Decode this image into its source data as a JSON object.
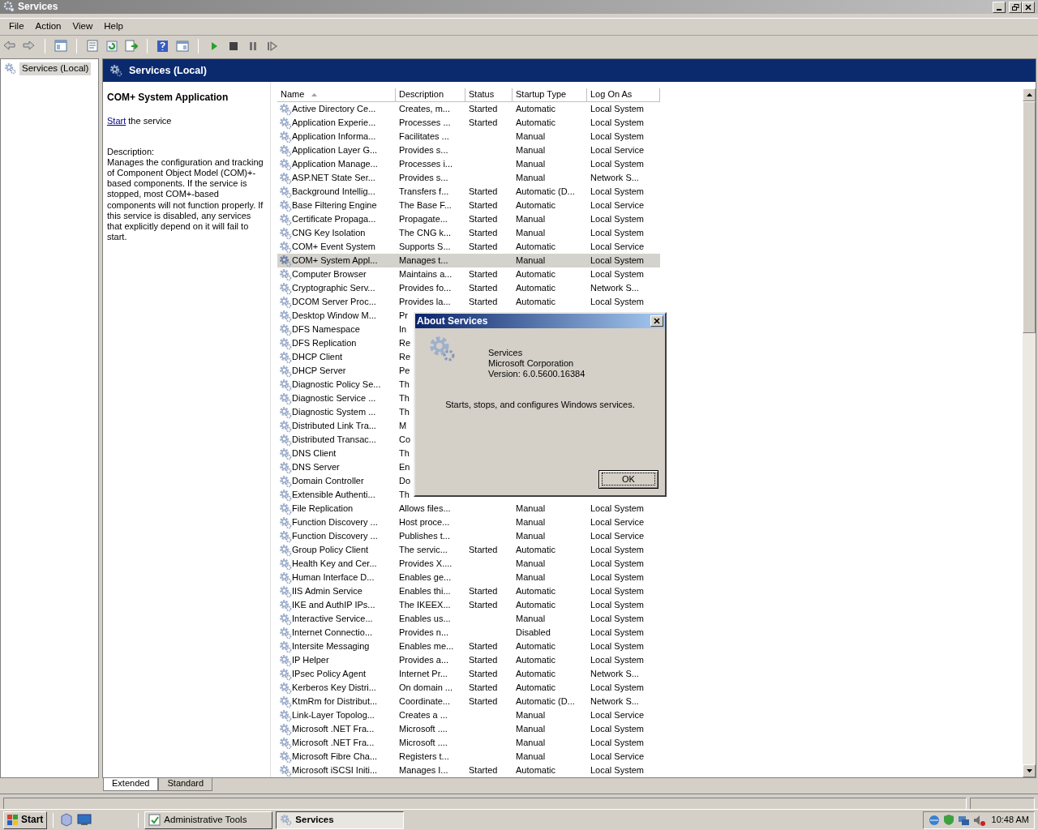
{
  "window": {
    "title": "Services"
  },
  "menu": [
    "File",
    "Action",
    "View",
    "Help"
  ],
  "tree": {
    "items": [
      {
        "label": "Services (Local)",
        "selected": true
      }
    ]
  },
  "panel_header": {
    "title": "Services (Local)"
  },
  "details": {
    "title": "COM+ System Application",
    "action_link": "Start",
    "action_text": "the service",
    "description_label": "Description:",
    "description": "Manages the configuration and tracking of Component Object Model (COM)+-based components. If the service is stopped, most COM+-based components will not function properly. If this service is disabled, any services that explicitly depend on it will fail to start."
  },
  "table": {
    "columns": [
      {
        "label": "Name",
        "sorted": true
      },
      {
        "label": "Description",
        "sorted": false
      },
      {
        "label": "Status",
        "sorted": false
      },
      {
        "label": "Startup Type",
        "sorted": false
      },
      {
        "label": "Log On As",
        "sorted": false
      }
    ],
    "rows": [
      {
        "name": "Active Directory Ce...",
        "description": "Creates, m...",
        "status": "Started",
        "startup_type": "Automatic",
        "log_on_as": "Local System",
        "selected": false
      },
      {
        "name": "Application Experie...",
        "description": "Processes ...",
        "status": "Started",
        "startup_type": "Automatic",
        "log_on_as": "Local System",
        "selected": false
      },
      {
        "name": "Application Informa...",
        "description": "Facilitates ...",
        "startup_type": "Manual",
        "log_on_as": "Local System",
        "selected": false
      },
      {
        "name": "Application Layer G...",
        "description": "Provides s...",
        "startup_type": "Manual",
        "log_on_as": "Local Service",
        "selected": false
      },
      {
        "name": "Application Manage...",
        "description": "Processes i...",
        "startup_type": "Manual",
        "log_on_as": "Local System",
        "selected": false
      },
      {
        "name": "ASP.NET State Ser...",
        "description": "Provides s...",
        "startup_type": "Manual",
        "log_on_as": "Network S...",
        "selected": false
      },
      {
        "name": "Background Intellig...",
        "description": "Transfers f...",
        "status": "Started",
        "startup_type": "Automatic (D...",
        "log_on_as": "Local System",
        "selected": false
      },
      {
        "name": "Base Filtering Engine",
        "description": "The Base F...",
        "status": "Started",
        "startup_type": "Automatic",
        "log_on_as": "Local Service",
        "selected": false
      },
      {
        "name": "Certificate Propaga...",
        "description": "Propagate...",
        "status": "Started",
        "startup_type": "Manual",
        "log_on_as": "Local System",
        "selected": false
      },
      {
        "name": "CNG Key Isolation",
        "description": "The CNG k...",
        "status": "Started",
        "startup_type": "Manual",
        "log_on_as": "Local System",
        "selected": false
      },
      {
        "name": "COM+ Event System",
        "description": "Supports S...",
        "status": "Started",
        "startup_type": "Automatic",
        "log_on_as": "Local Service",
        "selected": false
      },
      {
        "name": "COM+ System Appl...",
        "description": "Manages t...",
        "startup_type": "Manual",
        "log_on_as": "Local System",
        "selected": true
      },
      {
        "name": "Computer Browser",
        "description": "Maintains a...",
        "status": "Started",
        "startup_type": "Automatic",
        "log_on_as": "Local System",
        "selected": false
      },
      {
        "name": "Cryptographic Serv...",
        "description": "Provides fo...",
        "status": "Started",
        "startup_type": "Automatic",
        "log_on_as": "Network S...",
        "selected": false
      },
      {
        "name": "DCOM Server Proc...",
        "description": "Provides la...",
        "status": "Started",
        "startup_type": "Automatic",
        "log_on_as": "Local System",
        "selected": false
      },
      {
        "name": "Desktop Window M...",
        "description": "Pr",
        "selected": false
      },
      {
        "name": "DFS Namespace",
        "description": "In",
        "selected": false
      },
      {
        "name": "DFS Replication",
        "description": "Re",
        "selected": false
      },
      {
        "name": "DHCP Client",
        "description": "Re",
        "selected": false
      },
      {
        "name": "DHCP Server",
        "description": "Pe",
        "selected": false
      },
      {
        "name": "Diagnostic Policy Se...",
        "description": "Th",
        "selected": false
      },
      {
        "name": "Diagnostic Service ...",
        "description": "Th",
        "selected": false
      },
      {
        "name": "Diagnostic System ...",
        "description": "Th",
        "selected": false
      },
      {
        "name": "Distributed Link Tra...",
        "description": "M",
        "selected": false
      },
      {
        "name": "Distributed Transac...",
        "description": "Co",
        "selected": false
      },
      {
        "name": "DNS Client",
        "description": "Th",
        "selected": false
      },
      {
        "name": "DNS Server",
        "description": "En",
        "selected": false
      },
      {
        "name": "Domain Controller",
        "description": "Do",
        "selected": false
      },
      {
        "name": "Extensible Authenti...",
        "description": "Th",
        "selected": false
      },
      {
        "name": "File Replication",
        "description": "Allows files...",
        "startup_type": "Manual",
        "log_on_as": "Local System",
        "selected": false
      },
      {
        "name": "Function Discovery ...",
        "description": "Host proce...",
        "startup_type": "Manual",
        "log_on_as": "Local Service",
        "selected": false
      },
      {
        "name": "Function Discovery ...",
        "description": "Publishes t...",
        "startup_type": "Manual",
        "log_on_as": "Local Service",
        "selected": false
      },
      {
        "name": "Group Policy Client",
        "description": "The servic...",
        "status": "Started",
        "startup_type": "Automatic",
        "log_on_as": "Local System",
        "selected": false
      },
      {
        "name": "Health Key and Cer...",
        "description": "Provides X....",
        "startup_type": "Manual",
        "log_on_as": "Local System",
        "selected": false
      },
      {
        "name": "Human Interface D...",
        "description": "Enables ge...",
        "startup_type": "Manual",
        "log_on_as": "Local System",
        "selected": false
      },
      {
        "name": "IIS Admin Service",
        "description": "Enables thi...",
        "status": "Started",
        "startup_type": "Automatic",
        "log_on_as": "Local System",
        "selected": false
      },
      {
        "name": "IKE and AuthIP IPs...",
        "description": "The IKEEX...",
        "status": "Started",
        "startup_type": "Automatic",
        "log_on_as": "Local System",
        "selected": false
      },
      {
        "name": "Interactive Service...",
        "description": "Enables us...",
        "startup_type": "Manual",
        "log_on_as": "Local System",
        "selected": false
      },
      {
        "name": "Internet Connectio...",
        "description": "Provides n...",
        "startup_type": "Disabled",
        "log_on_as": "Local System",
        "selected": false
      },
      {
        "name": "Intersite Messaging",
        "description": "Enables me...",
        "status": "Started",
        "startup_type": "Automatic",
        "log_on_as": "Local System",
        "selected": false
      },
      {
        "name": "IP Helper",
        "description": "Provides a...",
        "status": "Started",
        "startup_type": "Automatic",
        "log_on_as": "Local System",
        "selected": false
      },
      {
        "name": "IPsec Policy Agent",
        "description": "Internet Pr...",
        "status": "Started",
        "startup_type": "Automatic",
        "log_on_as": "Network S...",
        "selected": false
      },
      {
        "name": "Kerberos Key Distri...",
        "description": "On domain ...",
        "status": "Started",
        "startup_type": "Automatic",
        "log_on_as": "Local System",
        "selected": false
      },
      {
        "name": "KtmRm for Distribut...",
        "description": "Coordinate...",
        "status": "Started",
        "startup_type": "Automatic (D...",
        "log_on_as": "Network S...",
        "selected": false
      },
      {
        "name": "Link-Layer Topolog...",
        "description": "Creates a ...",
        "startup_type": "Manual",
        "log_on_as": "Local Service",
        "selected": false
      },
      {
        "name": "Microsoft .NET Fra...",
        "description": "Microsoft ....",
        "startup_type": "Manual",
        "log_on_as": "Local System",
        "selected": false
      },
      {
        "name": "Microsoft .NET Fra...",
        "description": "Microsoft ....",
        "startup_type": "Manual",
        "log_on_as": "Local System",
        "selected": false
      },
      {
        "name": "Microsoft Fibre Cha...",
        "description": "Registers t...",
        "startup_type": "Manual",
        "log_on_as": "Local Service",
        "selected": false
      },
      {
        "name": "Microsoft iSCSI Initi...",
        "description": "Manages I...",
        "status": "Started",
        "startup_type": "Automatic",
        "log_on_as": "Local System",
        "selected": false
      }
    ]
  },
  "view_tabs": [
    {
      "label": "Extended",
      "selected": true
    },
    {
      "label": "Standard",
      "selected": false
    }
  ],
  "dialog": {
    "title": "About Services",
    "product": "Services",
    "company": "Microsoft Corporation",
    "version": "Version: 6.0.5600.16384",
    "summary": "Starts, stops, and configures Windows services.",
    "ok_button": "OK"
  },
  "taskbar": {
    "start": "Start",
    "buttons": [
      {
        "label": "Administrative Tools",
        "selected": false
      },
      {
        "label": "Services",
        "selected": true
      }
    ],
    "clock": "10:48 AM"
  }
}
